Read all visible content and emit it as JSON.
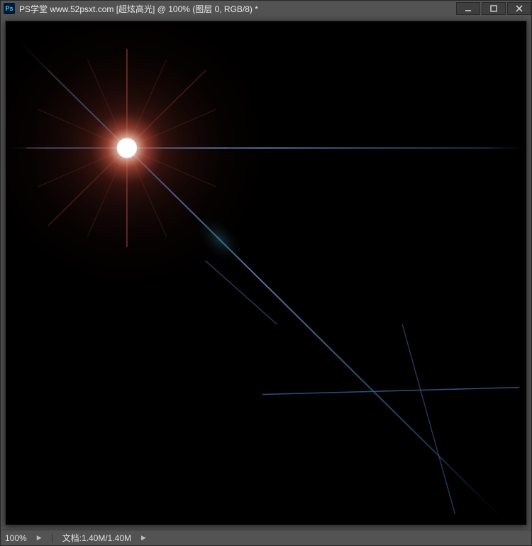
{
  "titlebar": {
    "app_abbr": "Ps",
    "title": "PS学堂 www.52psxt.com [超炫高光] @ 100% (图层 0, RGB/8) *"
  },
  "statusbar": {
    "zoom": "100%",
    "doc_label": "文档:",
    "doc_size": "1.40M/1.40M"
  },
  "colors": {
    "streak": "#3a6aa6",
    "flare_core": "#ffffff",
    "flare_red": "#cc4a3a",
    "ghost": "#2a5b6e"
  }
}
